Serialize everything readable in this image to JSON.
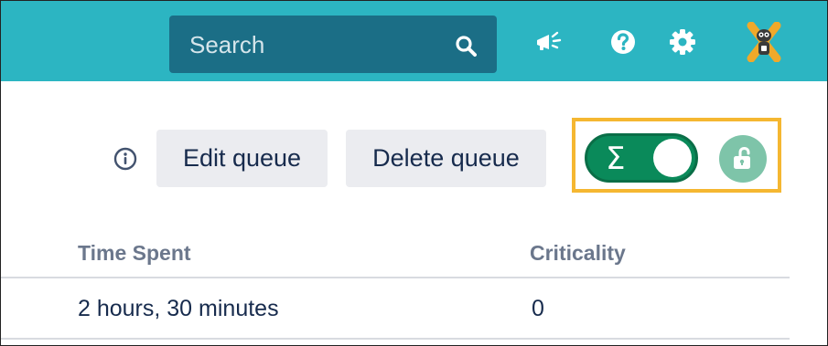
{
  "header": {
    "search": {
      "placeholder": "Search"
    },
    "icons": {
      "announcement": "megaphone-icon",
      "help": "question-mark-icon",
      "settings": "gear-icon",
      "profile": "avatar-icon"
    }
  },
  "toolbar": {
    "info_icon": "info-icon",
    "edit_label": "Edit queue",
    "delete_label": "Delete queue",
    "sum_toggle": {
      "symbol": "Σ",
      "on": true
    },
    "lock_icon": "unlock-icon"
  },
  "table": {
    "columns": [
      "Time Spent",
      "Criticality"
    ],
    "rows": [
      [
        "2 hours, 30 minutes",
        "0"
      ]
    ]
  },
  "colors": {
    "header_bg": "#2cb5c2",
    "search_bg": "#1b6e86",
    "toggle_bg": "#0a8a5a",
    "lock_bg": "#7ec4a9",
    "highlight_border": "#f5b731",
    "button_bg": "#ebecf0"
  }
}
